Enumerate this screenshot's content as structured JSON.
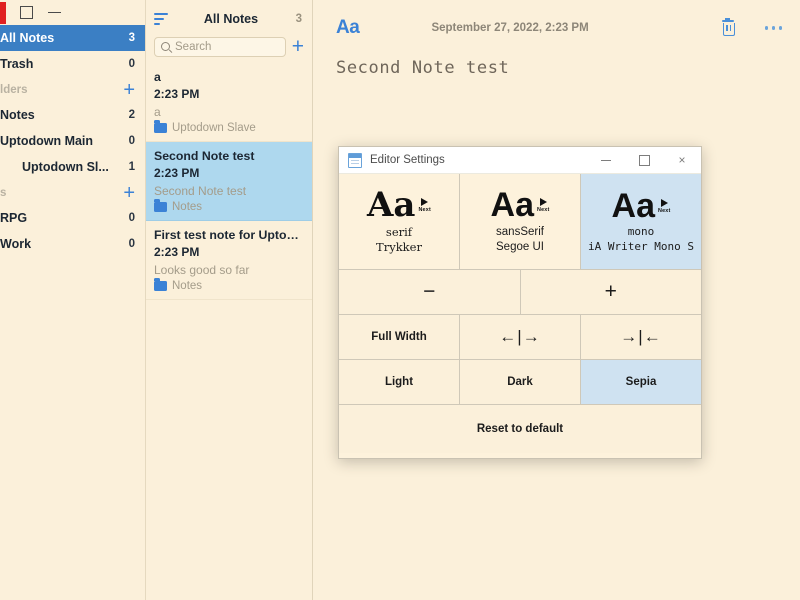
{
  "window_controls": {
    "close": "close",
    "maximize": "maximize",
    "minimize": "minimize"
  },
  "sidebar": {
    "rows": [
      {
        "label": "All Notes",
        "count": "3",
        "selected": true,
        "type": "row"
      },
      {
        "label": "Trash",
        "count": "0",
        "selected": false,
        "type": "row"
      },
      {
        "label": "lders",
        "count": "+",
        "selected": false,
        "type": "head"
      },
      {
        "label": "Notes",
        "count": "2",
        "selected": false,
        "type": "row"
      },
      {
        "label": "Uptodown Main",
        "count": "0",
        "selected": false,
        "type": "row"
      },
      {
        "label": "Uptodown Sl...",
        "count": "1",
        "selected": false,
        "type": "row",
        "indent": true
      },
      {
        "label": "s",
        "count": "+",
        "selected": false,
        "type": "head"
      },
      {
        "label": "RPG",
        "count": "0",
        "selected": false,
        "type": "row"
      },
      {
        "label": "Work",
        "count": "0",
        "selected": false,
        "type": "row"
      }
    ]
  },
  "notelist": {
    "title": "All Notes",
    "count": "3",
    "sort_icon": "sort-icon",
    "search_placeholder": "Search",
    "add_label": "+",
    "notes": [
      {
        "title": "a",
        "time": "2:23 PM",
        "preview": "a",
        "folder": "Uptodown Slave",
        "selected": false
      },
      {
        "title": "Second Note test",
        "time": "2:23 PM",
        "preview": "Second Note test",
        "folder": "Notes",
        "selected": true
      },
      {
        "title": "First test note for Uptod...",
        "time": "2:23 PM",
        "preview": "Looks good so far",
        "folder": "Notes",
        "selected": false
      }
    ]
  },
  "editor": {
    "font_button": "Aa",
    "date": "September 27, 2022, 2:23 PM",
    "trash_icon": "trash-icon",
    "more_icon": "more-options-icon",
    "body_text": "Second Note test"
  },
  "dialog": {
    "title": "Editor Settings",
    "icon": "notepad-icon",
    "controls": {
      "minimize": "—",
      "maximize": "□",
      "close": "×"
    },
    "fonts": [
      {
        "sample": "Aa",
        "next": "Next",
        "name": "serif",
        "family": "Trykker",
        "selected": false
      },
      {
        "sample": "Aa",
        "next": "Next",
        "name": "sansSerif",
        "family": "Segoe UI",
        "selected": false
      },
      {
        "sample": "Aa",
        "next": "Next",
        "name": "mono",
        "family": "iA Writer Mono S",
        "selected": true
      }
    ],
    "size_row": [
      {
        "label": "−",
        "name": "decrease-font-size",
        "selected": false
      },
      {
        "label": "+",
        "name": "increase-font-size",
        "selected": false
      }
    ],
    "width_row": [
      {
        "label": "Full Width",
        "name": "full-width",
        "selected": false
      },
      {
        "label": "←|→",
        "name": "widen",
        "selected": false
      },
      {
        "label": "→|←",
        "name": "narrow",
        "selected": false
      }
    ],
    "theme_row": [
      {
        "label": "Light",
        "name": "theme-light",
        "selected": false
      },
      {
        "label": "Dark",
        "name": "theme-dark",
        "selected": false
      },
      {
        "label": "Sepia",
        "name": "theme-sepia",
        "selected": true
      }
    ],
    "reset_label": "Reset to default"
  },
  "colors": {
    "bg_sepia": "#fbf0da",
    "accent_blue": "#3b82d6",
    "selection_blue": "#3b7fc4",
    "list_selection": "#aed8ee",
    "dialog_selection": "#cfe2f1"
  }
}
